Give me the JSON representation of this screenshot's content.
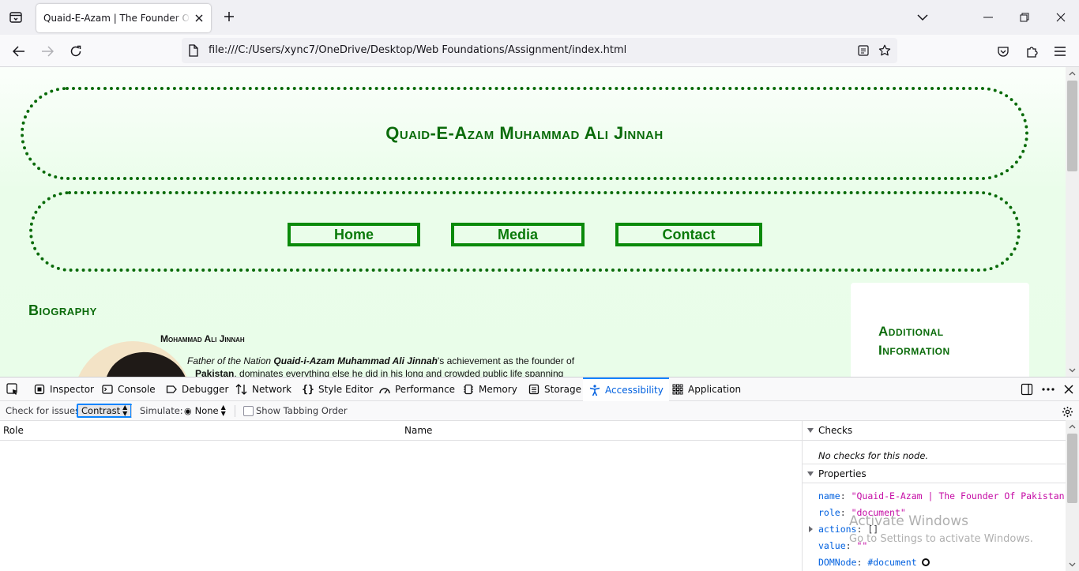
{
  "browser": {
    "tab_title": "Quaid-E-Azam | The Founder Of Pakistan",
    "url": "file:///C:/Users/xync7/OneDrive/Desktop/Web Foundations/Assignment/index.html",
    "icons": {
      "list_all_tabs": "tab-list-icon",
      "close_tab": "close-icon",
      "new_tab": "plus-icon",
      "tabs_overflow": "chevron-down-icon",
      "minimize": "minimize-icon",
      "restore": "restore-icon",
      "close_window": "close-icon",
      "back": "arrow-left-icon",
      "forward": "arrow-right-icon",
      "reload": "reload-icon",
      "page": "page-icon",
      "reader_view": "reader-view-icon",
      "bookmark": "star-icon",
      "pocket": "pocket-icon",
      "extensions": "puzzle-icon",
      "menu": "hamburger-icon"
    }
  },
  "page": {
    "title": "Quaid-E-Azam Muhammad Ali Jinnah",
    "nav": [
      "Home",
      "Media",
      "Contact"
    ],
    "bio_heading": "Biography",
    "bio_subheading": "Mohammad Ali Jinnah",
    "bio_lead_italic": "Father of the Nation ",
    "bio_name_bold": "Quaid-i-Azam Muhammad Ali Jinnah",
    "bio_after_name": "'s achievement as the founder of",
    "bio_pakistan_bold": "Pakistan",
    "bio_rest": ", dominates everything else he did in his long and crowded public life spanning",
    "sidebar_title": "Additional Information",
    "colors": {
      "accent_green": "#0a6b0a",
      "nav_border": "#0a8a0a"
    }
  },
  "devtools": {
    "tabs": [
      "Inspector",
      "Console",
      "Debugger",
      "Network",
      "Style Editor",
      "Performance",
      "Memory",
      "Storage",
      "Accessibility",
      "Application"
    ],
    "active_tab": "Accessibility",
    "check_for_issues_label": "Check for issues:",
    "check_for_issues_value": "Contrast",
    "simulate_label": "Simulate:",
    "simulate_value": "None",
    "show_tabbing_order": "Show Tabbing Order",
    "columns": {
      "role": "Role",
      "name": "Name"
    },
    "checks_header": "Checks",
    "no_checks": "No checks for this node.",
    "properties_header": "Properties",
    "properties": {
      "name_key": "name",
      "name_val": "\"Quaid-E-Azam | The Founder Of Pakistan\"",
      "role_key": "role",
      "role_val": "\"document\"",
      "actions_key": "actions",
      "actions_val": "[]",
      "value_key": "value",
      "value_val": "\"\"",
      "domnode_key": "DOMNode",
      "domnode_val": "#document"
    },
    "colors": {
      "active_tab": "#0060df",
      "string": "#c50ca5"
    }
  },
  "watermark": {
    "title": "Activate Windows",
    "subtitle": "Go to Settings to activate Windows."
  }
}
